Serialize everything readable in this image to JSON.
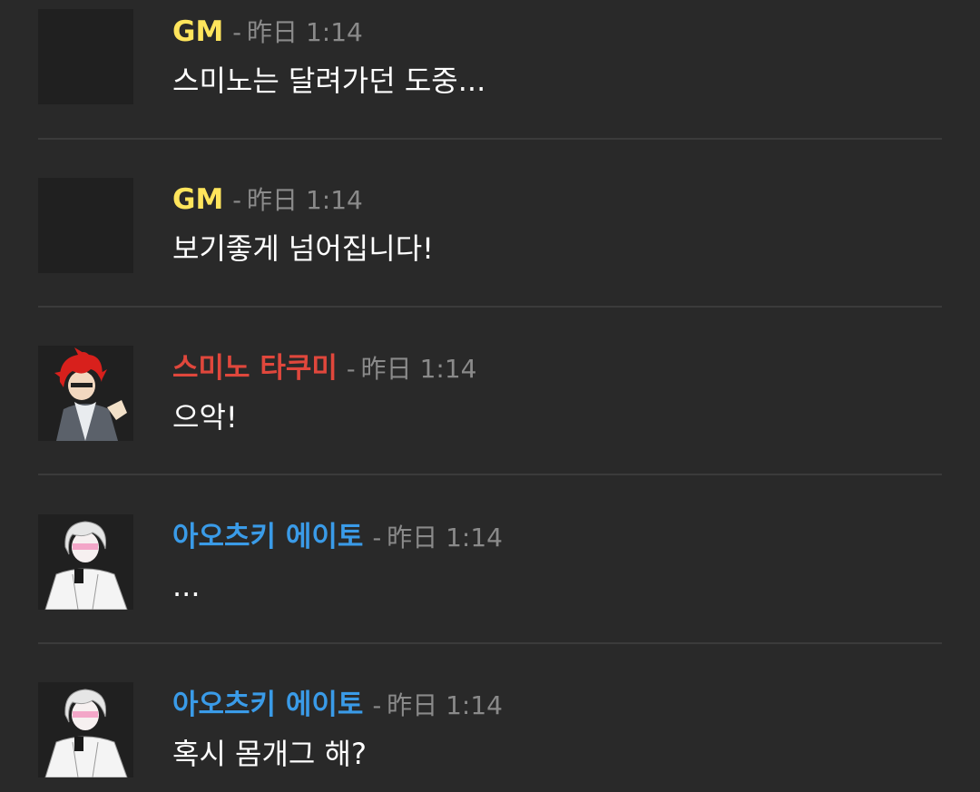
{
  "colors": {
    "background": "#292929",
    "gm": "#ffe55c",
    "sumino": "#e0473c",
    "aotsuki": "#3a9be8",
    "timestamp": "#8a8a8a",
    "divider": "#3b3b3b"
  },
  "messages": [
    {
      "author": "GM",
      "author_color": "gm",
      "separator": "-",
      "timestamp": "昨日 1:14",
      "text": "스미노는 달려가던 도중...",
      "avatar": "blank-avatar"
    },
    {
      "author": "GM",
      "author_color": "gm",
      "separator": "-",
      "timestamp": "昨日 1:14",
      "text": "보기좋게 넘어집니다!",
      "avatar": "blank-avatar"
    },
    {
      "author": "스미노 타쿠미",
      "author_color": "sumino",
      "separator": "-",
      "timestamp": "昨日 1:14",
      "text": "으악!",
      "avatar": "red-hair-character-avatar"
    },
    {
      "author": "아오츠키 에이토",
      "author_color": "aotsuki",
      "separator": "-",
      "timestamp": "昨日 1:14",
      "text": "...",
      "avatar": "white-hair-character-avatar"
    },
    {
      "author": "아오츠키 에이토",
      "author_color": "aotsuki",
      "separator": "-",
      "timestamp": "昨日 1:14",
      "text": "혹시 몸개그 해?",
      "avatar": "white-hair-character-avatar"
    }
  ]
}
